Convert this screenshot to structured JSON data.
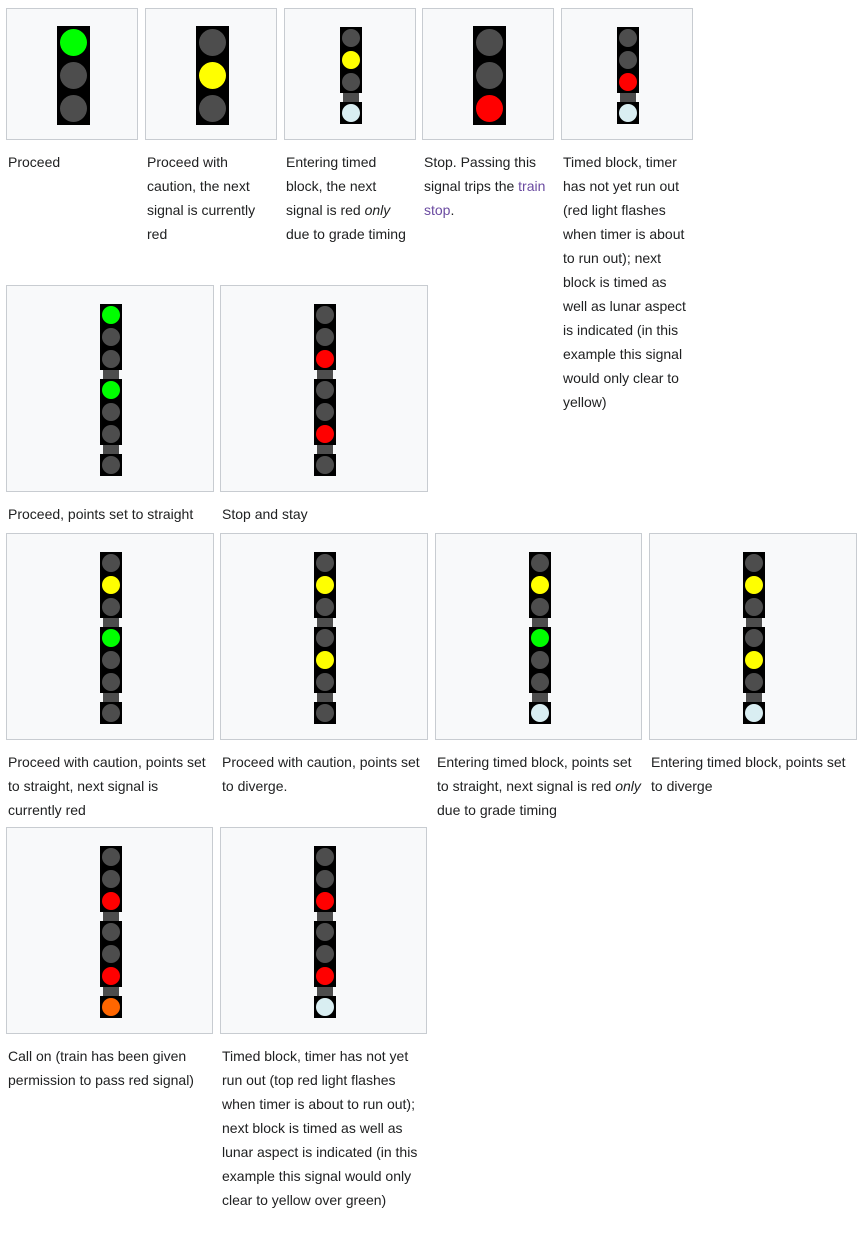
{
  "colors": {
    "off": "#4d4d4d",
    "green": "#00ff00",
    "yellow": "#ffff00",
    "red": "#ff0000",
    "lunar": "#d9eef2",
    "orange": "#ff6600",
    "link": "#6b4ba1"
  },
  "items": [
    {
      "signal": {
        "heads": [
          [
            "green",
            "off",
            "off"
          ]
        ],
        "big": true
      },
      "caption": [
        {
          "t": "Proceed"
        }
      ]
    },
    {
      "signal": {
        "heads": [
          [
            "off",
            "yellow",
            "off"
          ]
        ],
        "big": true
      },
      "caption": [
        {
          "t": "Proceed with caution, the next signal is currently red"
        }
      ]
    },
    {
      "signal": {
        "heads": [
          [
            "off",
            "yellow",
            "off"
          ],
          [
            "lunar"
          ]
        ]
      },
      "caption": [
        {
          "t": "Entering timed block, the next signal is red "
        },
        {
          "t": "only",
          "i": true
        },
        {
          "t": " due to grade timing"
        }
      ]
    },
    {
      "signal": {
        "heads": [
          [
            "off",
            "off",
            "red"
          ]
        ],
        "big": true
      },
      "caption": [
        {
          "t": "Stop. Passing this signal trips the "
        },
        {
          "t": "train stop",
          "link": true
        },
        {
          "t": "."
        }
      ]
    },
    {
      "signal": {
        "heads": [
          [
            "off",
            "off",
            "red"
          ],
          [
            "lunar"
          ]
        ]
      },
      "caption": [
        {
          "t": "Timed block, timer has not yet run out (red light flashes when timer is about to run out); next block is timed as well as lunar aspect is indicated (in this example this signal would only clear to yellow)"
        }
      ]
    },
    {
      "signal": {
        "heads": [
          [
            "green",
            "off",
            "off"
          ],
          [
            "green",
            "off",
            "off"
          ],
          [
            "off"
          ]
        ]
      },
      "caption": [
        {
          "t": "Proceed, points set to straight"
        }
      ]
    },
    {
      "signal": {
        "heads": [
          [
            "off",
            "off",
            "red"
          ],
          [
            "off",
            "off",
            "red"
          ],
          [
            "off"
          ]
        ]
      },
      "caption": [
        {
          "t": "Stop and stay"
        }
      ]
    },
    {
      "signal": {
        "heads": [
          [
            "off",
            "yellow",
            "off"
          ],
          [
            "green",
            "off",
            "off"
          ],
          [
            "off"
          ]
        ]
      },
      "caption": [
        {
          "t": "Proceed with caution, points set to straight, next signal is currently red"
        }
      ]
    },
    {
      "signal": {
        "heads": [
          [
            "off",
            "yellow",
            "off"
          ],
          [
            "off",
            "yellow",
            "off"
          ],
          [
            "off"
          ]
        ]
      },
      "caption": [
        {
          "t": "Proceed with caution, points set to diverge."
        }
      ]
    },
    {
      "signal": {
        "heads": [
          [
            "off",
            "yellow",
            "off"
          ],
          [
            "green",
            "off",
            "off"
          ],
          [
            "lunar"
          ]
        ]
      },
      "caption": [
        {
          "t": "Entering timed block, points set to straight, next signal is red "
        },
        {
          "t": "only",
          "i": true
        },
        {
          "t": " due to grade timing"
        }
      ]
    },
    {
      "signal": {
        "heads": [
          [
            "off",
            "yellow",
            "off"
          ],
          [
            "off",
            "yellow",
            "off"
          ],
          [
            "lunar"
          ]
        ]
      },
      "caption": [
        {
          "t": "Entering timed block, points set to diverge"
        }
      ]
    },
    {
      "signal": {
        "heads": [
          [
            "off",
            "off",
            "red"
          ],
          [
            "off",
            "off",
            "red"
          ],
          [
            "orange"
          ]
        ]
      },
      "caption": [
        {
          "t": "Call on (train has been given permission to pass red signal)"
        }
      ]
    },
    {
      "signal": {
        "heads": [
          [
            "off",
            "off",
            "red"
          ],
          [
            "off",
            "off",
            "red"
          ],
          [
            "lunar"
          ]
        ]
      },
      "caption": [
        {
          "t": "Timed block, timer has not yet run out (top red light flashes when timer is about to run out); next block is timed as well as lunar aspect is indicated (in this example this signal would only clear to yellow over green)"
        }
      ]
    }
  ]
}
